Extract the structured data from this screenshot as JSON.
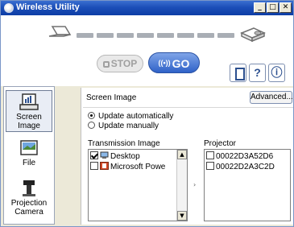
{
  "window": {
    "title": "Wireless Utility"
  },
  "controls": {
    "minimize": "_",
    "maximize": "□",
    "close": "✕"
  },
  "toolbar": {
    "stop_label": "STOP",
    "go_label": "GO",
    "go_icon": "((•))",
    "help_label": "?",
    "info_label": "ⓘ"
  },
  "sidebar": {
    "items": [
      {
        "label": "Screen Image",
        "icon": "screen-image-icon",
        "selected": true
      },
      {
        "label": "File",
        "icon": "file-icon",
        "selected": false
      },
      {
        "label": "Projection Camera",
        "label_lines": [
          "Projection",
          "Camera"
        ],
        "icon": "projection-camera-icon",
        "selected": false
      }
    ]
  },
  "panel": {
    "title": "Screen Image",
    "advanced_label": "Advanced...",
    "update_options": [
      {
        "label": "Update automatically",
        "selected": true
      },
      {
        "label": "Update manually",
        "selected": false
      }
    ],
    "transmission_label": "Transmission Image",
    "transmission_items": [
      {
        "label": "Desktop",
        "checked": true,
        "icon": "desktop-icon"
      },
      {
        "label": "Microsoft Powe",
        "checked": false,
        "icon": "powerpoint-icon"
      }
    ],
    "projector_label": "Projector",
    "projectors": [
      {
        "label": "00022D3A52D6",
        "checked": false
      },
      {
        "label": "00022D2A3C2D",
        "checked": false
      }
    ]
  },
  "colors": {
    "titlebar": "#1c4fb8",
    "go_button": "#2f62c8",
    "stop_button_text": "#a0a0a0"
  }
}
